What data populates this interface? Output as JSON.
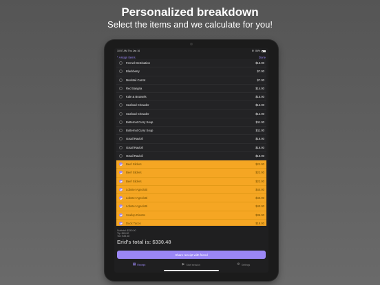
{
  "marketing": {
    "headline": "Personalized breakdown",
    "subhead": "Select the items and we calculate for you!"
  },
  "status": {
    "time": "10:57 AM",
    "date": "Thu Jan 16",
    "battery": "86%"
  },
  "nav": {
    "back_label": "Assign Items",
    "done_label": "Done"
  },
  "items": [
    {
      "name": "Fennel Destination",
      "price": "$15.00",
      "selected": false
    },
    {
      "name": "Blackberry",
      "price": "$7.00",
      "selected": false
    },
    {
      "name": "Mocktail Carrot",
      "price": "$7.00",
      "selected": false
    },
    {
      "name": "Red Sangria",
      "price": "$14.00",
      "selected": false
    },
    {
      "name": "Kale & Brussels",
      "price": "$15.00",
      "selected": false
    },
    {
      "name": "Seafood Chowder",
      "price": "$12.00",
      "selected": false
    },
    {
      "name": "Seafood Chowder",
      "price": "$12.00",
      "selected": false
    },
    {
      "name": "Butternut Curry Soup",
      "price": "$11.00",
      "selected": false
    },
    {
      "name": "Butternut Curry Soup",
      "price": "$11.00",
      "selected": false
    },
    {
      "name": "Oxtail Ravioli",
      "price": "$16.00",
      "selected": false
    },
    {
      "name": "Oxtail Ravioli",
      "price": "$16.00",
      "selected": false
    },
    {
      "name": "Oxtail Ravioli",
      "price": "$16.00",
      "selected": false
    },
    {
      "name": "Beef Sliders",
      "price": "$22.00",
      "selected": true
    },
    {
      "name": "Beef Sliders",
      "price": "$22.00",
      "selected": true
    },
    {
      "name": "Beef Sliders",
      "price": "$22.00",
      "selected": true
    },
    {
      "name": "Lobster Agnolotti",
      "price": "$40.00",
      "selected": true
    },
    {
      "name": "Lobster Agnolotti",
      "price": "$40.00",
      "selected": true
    },
    {
      "name": "Lobster Agnolotti",
      "price": "$40.00",
      "selected": true
    },
    {
      "name": "Scallop Risotto",
      "price": "$36.00",
      "selected": true
    },
    {
      "name": "Duck Tacos",
      "price": "$18.00",
      "selected": true
    }
  ],
  "summary": {
    "subtotal": "Subtotal: $240.00",
    "tip": "Tip: $45.00",
    "tax": "Tax: $45.48",
    "total": "Erid's total is: $330.48"
  },
  "share_button": "Share receipt with friend",
  "tabs": [
    {
      "label": "Receipt",
      "icon": "receipt-icon",
      "glyph": "▦",
      "active": true
    },
    {
      "label": "Start session",
      "icon": "play-icon",
      "glyph": "▶",
      "active": false
    },
    {
      "label": "Settings",
      "icon": "gear-icon",
      "glyph": "⚙",
      "active": false
    }
  ],
  "colors": {
    "accent": "#9b87f5",
    "selected_row": "#f5a623"
  }
}
